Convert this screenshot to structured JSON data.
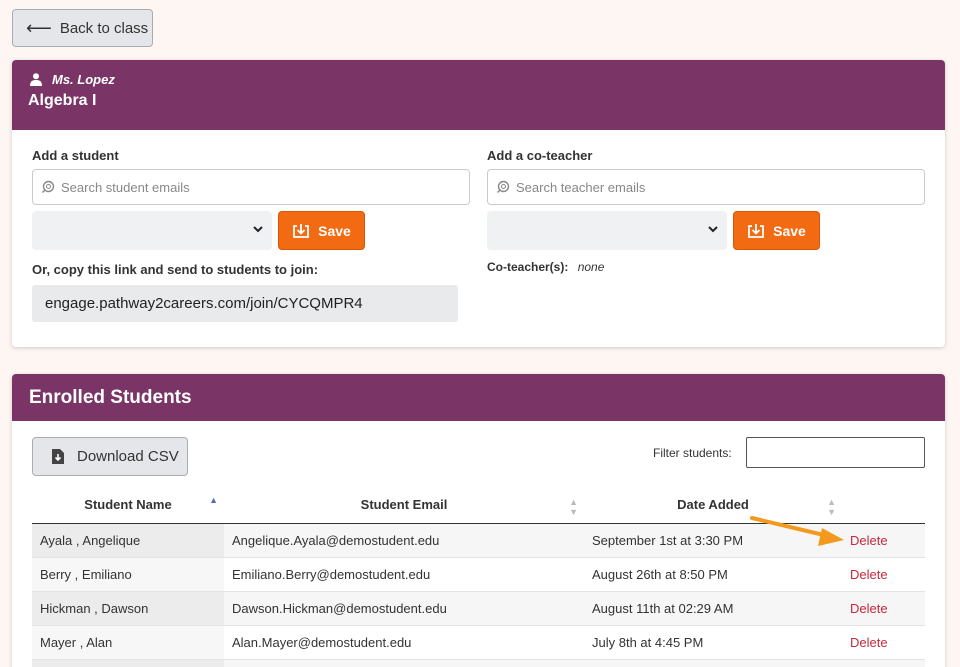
{
  "nav": {
    "back_label": "Back to class"
  },
  "class_header": {
    "teacher": "Ms. Lopez",
    "class_name": "Algebra I"
  },
  "add_student": {
    "label": "Add a student",
    "search_placeholder": "Search student emails",
    "save_label": "Save",
    "copy_label": "Or, copy this link and send to students to join:",
    "join_link": "engage.pathway2careers.com/join/CYCQMPR4"
  },
  "add_coteacher": {
    "label": "Add a co-teacher",
    "search_placeholder": "Search teacher emails",
    "save_label": "Save",
    "coteachers_label": "Co-teacher(s):",
    "coteachers_value": "none"
  },
  "enrolled": {
    "title": "Enrolled Students",
    "download_label": "Download CSV",
    "filter_label": "Filter students:",
    "columns": [
      "Student Name",
      "Student Email",
      "Date Added"
    ],
    "rows": [
      {
        "name": "Ayala , Angelique",
        "email": "Angelique.Ayala@demostudent.edu",
        "date": "September 1st at 3:30 PM",
        "action": "Delete"
      },
      {
        "name": "Berry , Emiliano",
        "email": "Emiliano.Berry@demostudent.edu",
        "date": "August 26th at 8:50 PM",
        "action": "Delete"
      },
      {
        "name": "Hickman , Dawson",
        "email": "Dawson.Hickman@demostudent.edu",
        "date": "August 11th at 02:29 AM",
        "action": "Delete"
      },
      {
        "name": "Mayer , Alan",
        "email": "Alan.Mayer@demostudent.edu",
        "date": "July 8th at 4:45 PM",
        "action": "Delete"
      },
      {
        "name": "",
        "email": "",
        "date": "",
        "action": ""
      }
    ]
  },
  "colors": {
    "header": "#7a3566",
    "save": "#f26a12",
    "delete": "#c8283c",
    "annotation_arrow": "#f39a1e"
  }
}
